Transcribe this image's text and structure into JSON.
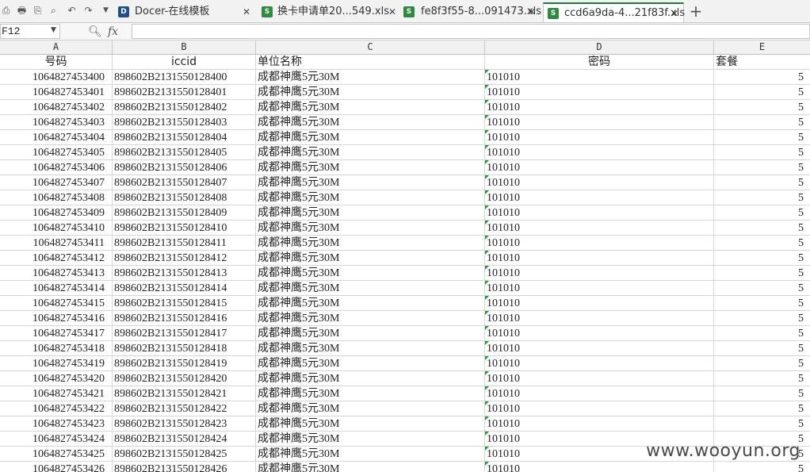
{
  "tabs": [
    {
      "label": "Docer-在线模板",
      "icon": "docer-icon",
      "active": false
    },
    {
      "label": "换卡申请单20...549.xls",
      "icon": "xls-file-icon",
      "active": false
    },
    {
      "label": "fe8f3f55-8...091473.xls",
      "icon": "xls-file-icon",
      "active": false
    },
    {
      "label": "ccd6a9da-4...21f83f.xls",
      "icon": "xls-file-icon",
      "active": true
    }
  ],
  "formula_bar": {
    "name_box": "F12",
    "fx_label": "fx",
    "formula": ""
  },
  "columns": [
    "A",
    "B",
    "C",
    "D",
    "E"
  ],
  "header_row": {
    "a": "号码",
    "b": "iccid",
    "c": "单位名称",
    "d": "密码",
    "e": "套餐"
  },
  "rows": [
    {
      "a": "1064827453400",
      "b": "898602B2131550128400",
      "c": "成都神鹰5元30M",
      "d": "101010",
      "e": "5"
    },
    {
      "a": "1064827453401",
      "b": "898602B2131550128401",
      "c": "成都神鹰5元30M",
      "d": "101010",
      "e": "5"
    },
    {
      "a": "1064827453402",
      "b": "898602B2131550128402",
      "c": "成都神鹰5元30M",
      "d": "101010",
      "e": "5"
    },
    {
      "a": "1064827453403",
      "b": "898602B2131550128403",
      "c": "成都神鹰5元30M",
      "d": "101010",
      "e": "5"
    },
    {
      "a": "1064827453404",
      "b": "898602B2131550128404",
      "c": "成都神鹰5元30M",
      "d": "101010",
      "e": "5"
    },
    {
      "a": "1064827453405",
      "b": "898602B2131550128405",
      "c": "成都神鹰5元30M",
      "d": "101010",
      "e": "5"
    },
    {
      "a": "1064827453406",
      "b": "898602B2131550128406",
      "c": "成都神鹰5元30M",
      "d": "101010",
      "e": "5"
    },
    {
      "a": "1064827453407",
      "b": "898602B2131550128407",
      "c": "成都神鹰5元30M",
      "d": "101010",
      "e": "5"
    },
    {
      "a": "1064827453408",
      "b": "898602B2131550128408",
      "c": "成都神鹰5元30M",
      "d": "101010",
      "e": "5"
    },
    {
      "a": "1064827453409",
      "b": "898602B2131550128409",
      "c": "成都神鹰5元30M",
      "d": "101010",
      "e": "5"
    },
    {
      "a": "1064827453410",
      "b": "898602B2131550128410",
      "c": "成都神鹰5元30M",
      "d": "101010",
      "e": "5"
    },
    {
      "a": "1064827453411",
      "b": "898602B2131550128411",
      "c": "成都神鹰5元30M",
      "d": "101010",
      "e": "5"
    },
    {
      "a": "1064827453412",
      "b": "898602B2131550128412",
      "c": "成都神鹰5元30M",
      "d": "101010",
      "e": "5"
    },
    {
      "a": "1064827453413",
      "b": "898602B2131550128413",
      "c": "成都神鹰5元30M",
      "d": "101010",
      "e": "5"
    },
    {
      "a": "1064827453414",
      "b": "898602B2131550128414",
      "c": "成都神鹰5元30M",
      "d": "101010",
      "e": "5"
    },
    {
      "a": "1064827453415",
      "b": "898602B2131550128415",
      "c": "成都神鹰5元30M",
      "d": "101010",
      "e": "5"
    },
    {
      "a": "1064827453416",
      "b": "898602B2131550128416",
      "c": "成都神鹰5元30M",
      "d": "101010",
      "e": "5"
    },
    {
      "a": "1064827453417",
      "b": "898602B2131550128417",
      "c": "成都神鹰5元30M",
      "d": "101010",
      "e": "5"
    },
    {
      "a": "1064827453418",
      "b": "898602B2131550128418",
      "c": "成都神鹰5元30M",
      "d": "101010",
      "e": "5"
    },
    {
      "a": "1064827453419",
      "b": "898602B2131550128419",
      "c": "成都神鹰5元30M",
      "d": "101010",
      "e": "5"
    },
    {
      "a": "1064827453420",
      "b": "898602B2131550128420",
      "c": "成都神鹰5元30M",
      "d": "101010",
      "e": "5"
    },
    {
      "a": "1064827453421",
      "b": "898602B2131550128421",
      "c": "成都神鹰5元30M",
      "d": "101010",
      "e": "5"
    },
    {
      "a": "1064827453422",
      "b": "898602B2131550128422",
      "c": "成都神鹰5元30M",
      "d": "101010",
      "e": "5"
    },
    {
      "a": "1064827453423",
      "b": "898602B2131550128423",
      "c": "成都神鹰5元30M",
      "d": "101010",
      "e": "5"
    },
    {
      "a": "1064827453424",
      "b": "898602B2131550128424",
      "c": "成都神鹰5元30M",
      "d": "101010",
      "e": "5"
    },
    {
      "a": "1064827453425",
      "b": "898602B2131550128425",
      "c": "成都神鹰5元30M",
      "d": "101010",
      "e": "5"
    },
    {
      "a": "1064827453426",
      "b": "898602B2131550128426",
      "c": "成都神鹰5元30M",
      "d": "101010",
      "e": "5"
    }
  ],
  "watermark": "www.wooyun.org",
  "colors": {
    "active_tab_accent": "#1e7a3a",
    "text_cell_marker": "#1e9e3a",
    "docer_icon": "#1f4e8c",
    "xls_icon": "#2d8a3e"
  }
}
